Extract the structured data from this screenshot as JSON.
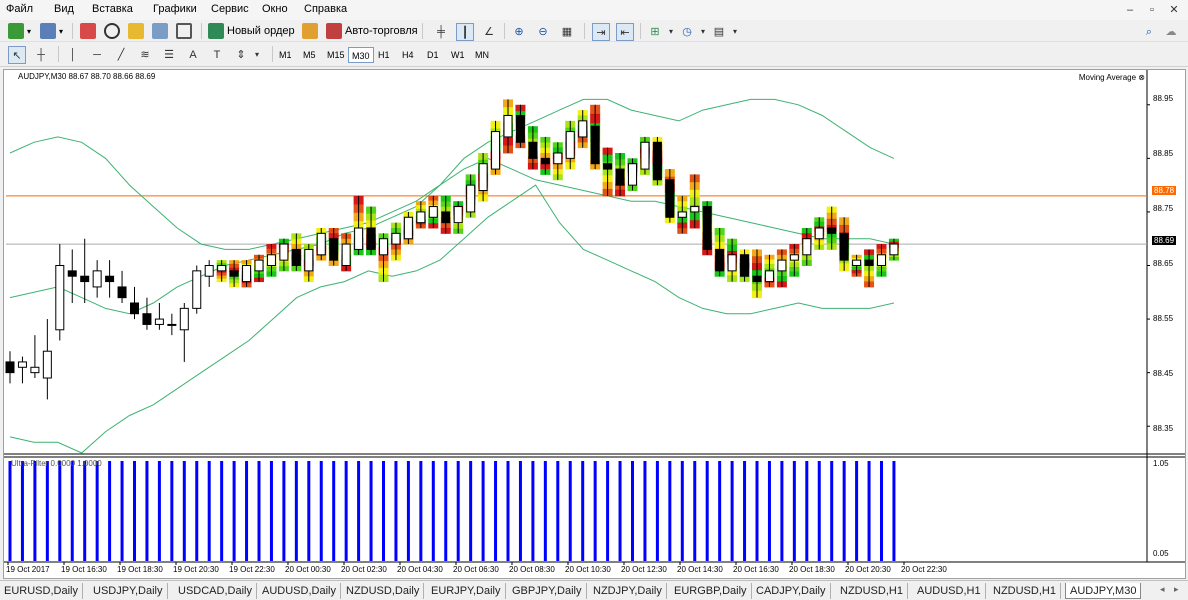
{
  "menu": [
    "Файл",
    "Вид",
    "Вставка",
    "Графики",
    "Сервис",
    "Окно",
    "Справка"
  ],
  "toolbar": {
    "new_order_label": "Новый ордер",
    "auto_trading_label": "Авто-торговля",
    "timeframes": [
      "M1",
      "M5",
      "M15",
      "M30",
      "H1",
      "H4",
      "D1",
      "W1",
      "MN"
    ],
    "active_timeframe": "M30"
  },
  "chart": {
    "title": "AUDJPY,M30  88.67 88.70 88.66 88.69",
    "indicator_label": "Moving Average",
    "sub_window_label": "Ultra-Filter 0.0000 1.0000",
    "price_axis": [
      "88.95",
      "88.85",
      "88.75",
      "88.65",
      "88.55",
      "88.45",
      "88.35"
    ],
    "red_line_price": "88.78",
    "current_price": "88.69",
    "sub_axis_top": "1.05",
    "sub_axis_bottom": "0.05",
    "time_axis": [
      "19 Oct 2017",
      "19 Oct 16:30",
      "19 Oct 18:30",
      "19 Oct 20:30",
      "19 Oct 22:30",
      "20 Oct 00:30",
      "20 Oct 02:30",
      "20 Oct 04:30",
      "20 Oct 06:30",
      "20 Oct 08:30",
      "20 Oct 10:30",
      "20 Oct 12:30",
      "20 Oct 14:30",
      "20 Oct 16:30",
      "20 Oct 18:30",
      "20 Oct 20:30",
      "20 Oct 22:30"
    ],
    "colors": {
      "up": "#ffffff",
      "down": "#000000",
      "band": "#3cb371",
      "red_line": "#ff6a00",
      "bars": "#0000ff"
    }
  },
  "chart_data": {
    "type": "candlestick",
    "symbol": "AUDJPY",
    "timeframe": "M30",
    "ylim": [
      88.3,
      89.0
    ],
    "candles": [
      {
        "o": 88.47,
        "h": 88.49,
        "l": 88.43,
        "c": 88.45
      },
      {
        "o": 88.46,
        "h": 88.48,
        "l": 88.43,
        "c": 88.47
      },
      {
        "o": 88.45,
        "h": 88.52,
        "l": 88.44,
        "c": 88.46
      },
      {
        "o": 88.44,
        "h": 88.55,
        "l": 88.4,
        "c": 88.49
      },
      {
        "o": 88.53,
        "h": 88.69,
        "l": 88.51,
        "c": 88.65
      },
      {
        "o": 88.64,
        "h": 88.68,
        "l": 88.58,
        "c": 88.63
      },
      {
        "o": 88.63,
        "h": 88.7,
        "l": 88.58,
        "c": 88.62
      },
      {
        "o": 88.61,
        "h": 88.66,
        "l": 88.59,
        "c": 88.64
      },
      {
        "o": 88.63,
        "h": 88.66,
        "l": 88.59,
        "c": 88.62
      },
      {
        "o": 88.61,
        "h": 88.64,
        "l": 88.58,
        "c": 88.59
      },
      {
        "o": 88.58,
        "h": 88.61,
        "l": 88.55,
        "c": 88.56
      },
      {
        "o": 88.56,
        "h": 88.59,
        "l": 88.53,
        "c": 88.54
      },
      {
        "o": 88.54,
        "h": 88.58,
        "l": 88.53,
        "c": 88.55
      },
      {
        "o": 88.54,
        "h": 88.56,
        "l": 88.52,
        "c": 88.54
      },
      {
        "o": 88.53,
        "h": 88.58,
        "l": 88.47,
        "c": 88.57
      },
      {
        "o": 88.57,
        "h": 88.65,
        "l": 88.56,
        "c": 88.64
      },
      {
        "o": 88.63,
        "h": 88.66,
        "l": 88.61,
        "c": 88.65
      },
      {
        "o": 88.64,
        "h": 88.66,
        "l": 88.62,
        "c": 88.65
      },
      {
        "o": 88.64,
        "h": 88.66,
        "l": 88.61,
        "c": 88.63
      },
      {
        "o": 88.62,
        "h": 88.66,
        "l": 88.61,
        "c": 88.65
      },
      {
        "o": 88.64,
        "h": 88.67,
        "l": 88.62,
        "c": 88.66
      },
      {
        "o": 88.65,
        "h": 88.69,
        "l": 88.63,
        "c": 88.67
      },
      {
        "o": 88.66,
        "h": 88.7,
        "l": 88.64,
        "c": 88.69
      },
      {
        "o": 88.68,
        "h": 88.71,
        "l": 88.64,
        "c": 88.65
      },
      {
        "o": 88.64,
        "h": 88.69,
        "l": 88.62,
        "c": 88.68
      },
      {
        "o": 88.67,
        "h": 88.72,
        "l": 88.66,
        "c": 88.71
      },
      {
        "o": 88.7,
        "h": 88.72,
        "l": 88.65,
        "c": 88.66
      },
      {
        "o": 88.65,
        "h": 88.71,
        "l": 88.64,
        "c": 88.69
      },
      {
        "o": 88.68,
        "h": 88.78,
        "l": 88.67,
        "c": 88.72
      },
      {
        "o": 88.72,
        "h": 88.76,
        "l": 88.67,
        "c": 88.68
      },
      {
        "o": 88.67,
        "h": 88.71,
        "l": 88.62,
        "c": 88.7
      },
      {
        "o": 88.69,
        "h": 88.73,
        "l": 88.66,
        "c": 88.71
      },
      {
        "o": 88.7,
        "h": 88.75,
        "l": 88.69,
        "c": 88.74
      },
      {
        "o": 88.73,
        "h": 88.77,
        "l": 88.72,
        "c": 88.75
      },
      {
        "o": 88.74,
        "h": 88.78,
        "l": 88.72,
        "c": 88.76
      },
      {
        "o": 88.75,
        "h": 88.78,
        "l": 88.71,
        "c": 88.73
      },
      {
        "o": 88.73,
        "h": 88.77,
        "l": 88.71,
        "c": 88.76
      },
      {
        "o": 88.75,
        "h": 88.82,
        "l": 88.74,
        "c": 88.8
      },
      {
        "o": 88.79,
        "h": 88.86,
        "l": 88.77,
        "c": 88.84
      },
      {
        "o": 88.83,
        "h": 88.92,
        "l": 88.82,
        "c": 88.9
      },
      {
        "o": 88.89,
        "h": 88.96,
        "l": 88.86,
        "c": 88.93
      },
      {
        "o": 88.93,
        "h": 88.95,
        "l": 88.87,
        "c": 88.88
      },
      {
        "o": 88.88,
        "h": 88.91,
        "l": 88.83,
        "c": 88.85
      },
      {
        "o": 88.85,
        "h": 88.89,
        "l": 88.82,
        "c": 88.84
      },
      {
        "o": 88.84,
        "h": 88.88,
        "l": 88.81,
        "c": 88.86
      },
      {
        "o": 88.85,
        "h": 88.92,
        "l": 88.83,
        "c": 88.9
      },
      {
        "o": 88.89,
        "h": 88.94,
        "l": 88.87,
        "c": 88.92
      },
      {
        "o": 88.91,
        "h": 88.95,
        "l": 88.83,
        "c": 88.84
      },
      {
        "o": 88.84,
        "h": 88.87,
        "l": 88.78,
        "c": 88.83
      },
      {
        "o": 88.83,
        "h": 88.86,
        "l": 88.78,
        "c": 88.8
      },
      {
        "o": 88.8,
        "h": 88.85,
        "l": 88.79,
        "c": 88.84
      },
      {
        "o": 88.83,
        "h": 88.89,
        "l": 88.82,
        "c": 88.88
      },
      {
        "o": 88.88,
        "h": 88.89,
        "l": 88.8,
        "c": 88.81
      },
      {
        "o": 88.81,
        "h": 88.83,
        "l": 88.73,
        "c": 88.74
      },
      {
        "o": 88.74,
        "h": 88.78,
        "l": 88.71,
        "c": 88.75
      },
      {
        "o": 88.75,
        "h": 88.82,
        "l": 88.72,
        "c": 88.76
      },
      {
        "o": 88.76,
        "h": 88.77,
        "l": 88.67,
        "c": 88.68
      },
      {
        "o": 88.68,
        "h": 88.72,
        "l": 88.63,
        "c": 88.64
      },
      {
        "o": 88.64,
        "h": 88.7,
        "l": 88.62,
        "c": 88.67
      },
      {
        "o": 88.67,
        "h": 88.68,
        "l": 88.62,
        "c": 88.63
      },
      {
        "o": 88.63,
        "h": 88.68,
        "l": 88.59,
        "c": 88.62
      },
      {
        "o": 88.62,
        "h": 88.67,
        "l": 88.61,
        "c": 88.64
      },
      {
        "o": 88.64,
        "h": 88.68,
        "l": 88.61,
        "c": 88.66
      },
      {
        "o": 88.66,
        "h": 88.69,
        "l": 88.63,
        "c": 88.67
      },
      {
        "o": 88.67,
        "h": 88.72,
        "l": 88.65,
        "c": 88.7
      },
      {
        "o": 88.7,
        "h": 88.74,
        "l": 88.68,
        "c": 88.72
      },
      {
        "o": 88.72,
        "h": 88.76,
        "l": 88.68,
        "c": 88.71
      },
      {
        "o": 88.71,
        "h": 88.74,
        "l": 88.64,
        "c": 88.66
      },
      {
        "o": 88.65,
        "h": 88.67,
        "l": 88.63,
        "c": 88.66
      },
      {
        "o": 88.66,
        "h": 88.68,
        "l": 88.61,
        "c": 88.65
      },
      {
        "o": 88.65,
        "h": 88.69,
        "l": 88.63,
        "c": 88.67
      },
      {
        "o": 88.67,
        "h": 88.7,
        "l": 88.66,
        "c": 88.69
      }
    ],
    "band_upper": [
      88.86,
      88.88,
      88.89,
      88.88,
      88.85,
      88.8,
      88.76,
      88.72,
      88.69,
      88.68,
      88.68,
      88.69,
      88.7,
      88.71,
      88.72,
      88.73,
      88.75,
      88.77,
      88.8,
      88.85,
      88.88,
      88.9,
      88.92,
      88.94,
      88.96,
      88.96,
      88.94,
      88.93,
      88.92,
      88.94,
      88.95,
      88.96,
      88.96,
      88.95,
      88.93,
      88.9,
      88.87,
      88.85
    ],
    "band_middle": [
      88.59,
      88.6,
      88.61,
      88.59,
      88.57,
      88.56,
      88.58,
      88.61,
      88.63,
      88.65,
      88.66,
      88.67,
      88.68,
      88.69,
      88.71,
      88.72,
      88.74,
      88.76,
      88.8,
      88.83,
      88.85,
      88.83,
      88.81,
      88.8,
      88.79,
      88.78,
      88.77,
      88.77,
      88.76,
      88.75,
      88.74,
      88.73,
      88.72,
      88.71,
      88.7,
      88.7,
      88.7,
      88.69
    ],
    "band_lower": [
      88.33,
      88.32,
      88.32,
      88.3,
      88.34,
      88.37,
      88.39,
      88.42,
      88.45,
      88.48,
      88.51,
      88.55,
      88.59,
      88.61,
      88.62,
      88.64,
      88.63,
      88.64,
      88.66,
      88.7,
      88.74,
      88.77,
      88.8,
      88.73,
      88.68,
      88.66,
      88.64,
      88.62,
      88.59,
      88.57,
      88.56,
      88.56,
      88.57,
      88.58,
      88.57,
      88.57,
      88.57,
      88.58
    ],
    "sub_values": [
      1,
      1,
      1,
      1,
      1,
      1,
      1,
      1,
      1,
      1,
      1,
      1,
      1,
      1,
      1,
      1,
      1,
      1,
      1,
      1,
      1,
      1,
      1,
      1,
      1,
      1,
      1,
      1,
      1,
      1,
      1,
      1,
      1,
      1,
      1,
      1,
      1,
      1,
      1,
      1,
      1,
      1,
      1,
      1,
      1,
      1,
      1,
      1,
      1,
      1,
      1,
      1,
      1,
      1,
      1,
      1,
      1,
      1,
      1,
      1,
      1,
      1,
      1,
      1,
      1,
      1,
      1,
      1,
      1,
      1,
      1,
      1
    ]
  },
  "tabs": [
    {
      "label": "EURUSD,Daily"
    },
    {
      "label": "USDJPY,Daily"
    },
    {
      "label": "USDCAD,Daily"
    },
    {
      "label": "AUDUSD,Daily"
    },
    {
      "label": "NZDUSD,Daily"
    },
    {
      "label": "EURJPY,Daily"
    },
    {
      "label": "GBPJPY,Daily"
    },
    {
      "label": "NZDJPY,Daily"
    },
    {
      "label": "EURGBP,Daily"
    },
    {
      "label": "CADJPY,Daily"
    },
    {
      "label": "NZDUSD,H1"
    },
    {
      "label": "AUDUSD,H1"
    },
    {
      "label": "NZDUSD,H1"
    },
    {
      "label": "AUDJPY,M30"
    }
  ],
  "active_tab": "AUDJPY,M30"
}
